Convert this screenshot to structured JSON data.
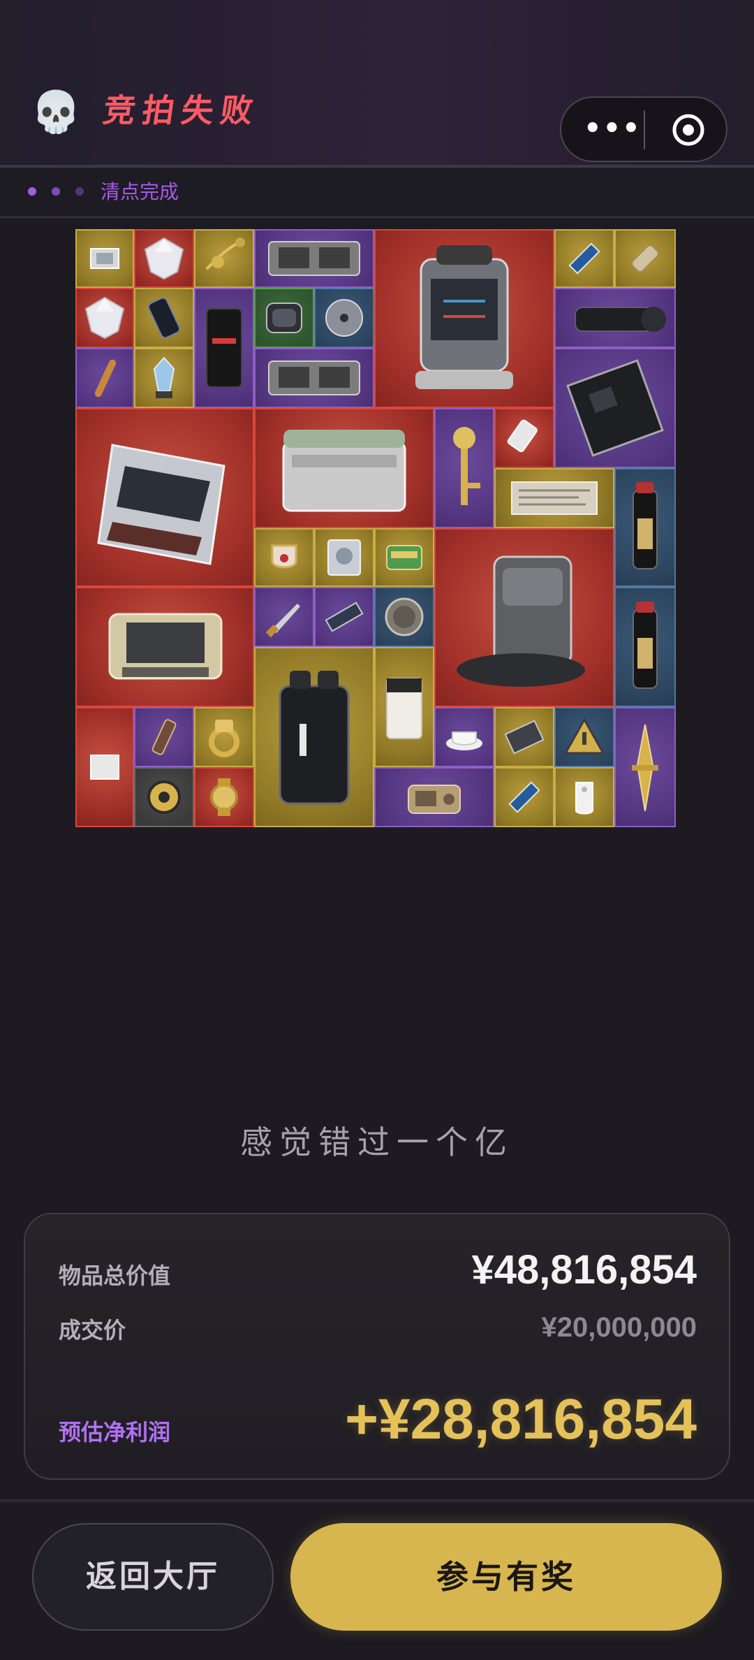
{
  "header": {
    "title": "竞拍失败",
    "skull_icon": "skull-icon",
    "capsule": {
      "more_icon": "more-dots-icon",
      "close_icon": "target-circle-icon"
    }
  },
  "status": {
    "dots": [
      "#a45be6",
      "#7e4bb6",
      "#54357d"
    ],
    "text": "清点完成"
  },
  "inventory": {
    "rarity_colors": {
      "red": "#c74a3d",
      "gold": "#b89c3c",
      "purple": "#6a4a9a",
      "blue": "#3a5877"
    },
    "items": [
      {
        "name": "cpu-chip-icon",
        "rarity": "gold"
      },
      {
        "name": "diamond-icon",
        "rarity": "red"
      },
      {
        "name": "gold-pendant-icon",
        "rarity": "gold"
      },
      {
        "name": "graphics-card-icon",
        "rarity": "purple"
      },
      {
        "name": "reactor-core-icon",
        "rarity": "red"
      },
      {
        "name": "ssd-icon",
        "rarity": "gold"
      },
      {
        "name": "battery-cell-icon",
        "rarity": "gold"
      },
      {
        "name": "diamond-icon",
        "rarity": "red"
      },
      {
        "name": "smartphone-icon",
        "rarity": "gold"
      },
      {
        "name": "coffee-bag-icon",
        "rarity": "purple"
      },
      {
        "name": "power-bank-icon",
        "rarity": "green"
      },
      {
        "name": "optical-disc-icon",
        "rarity": "blue"
      },
      {
        "name": "camera-lens-icon",
        "rarity": "purple"
      },
      {
        "name": "cigar-icon",
        "rarity": "purple"
      },
      {
        "name": "crystal-trophy-icon",
        "rarity": "gold"
      },
      {
        "name": "graphics-card-icon",
        "rarity": "purple"
      },
      {
        "name": "motherboard-icon",
        "rarity": "purple"
      },
      {
        "name": "server-rack-icon",
        "rarity": "red"
      },
      {
        "name": "car-battery-icon",
        "rarity": "red"
      },
      {
        "name": "golden-key-icon",
        "rarity": "purple"
      },
      {
        "name": "usb-drive-icon",
        "rarity": "red"
      },
      {
        "name": "newspaper-icon",
        "rarity": "gold"
      },
      {
        "name": "black-powder-icon",
        "rarity": "blue"
      },
      {
        "name": "ornate-cup-icon",
        "rarity": "gold"
      },
      {
        "name": "hard-drive-icon",
        "rarity": "gold"
      },
      {
        "name": "sardine-tin-icon",
        "rarity": "gold"
      },
      {
        "name": "robot-vacuum-dock-icon",
        "rarity": "red"
      },
      {
        "name": "rugged-laptop-case-icon",
        "rarity": "red"
      },
      {
        "name": "knife-icon",
        "rarity": "purple"
      },
      {
        "name": "ram-stick-icon",
        "rarity": "purple"
      },
      {
        "name": "ancient-coin-icon",
        "rarity": "blue"
      },
      {
        "name": "black-powder-icon",
        "rarity": "blue"
      },
      {
        "name": "power-station-icon",
        "rarity": "gold"
      },
      {
        "name": "coffee-box-icon",
        "rarity": "gold"
      },
      {
        "name": "paper-note-icon",
        "rarity": "red"
      },
      {
        "name": "chocolate-bar-icon",
        "rarity": "purple"
      },
      {
        "name": "gold-ring-icon",
        "rarity": "gold"
      },
      {
        "name": "teacup-icon",
        "rarity": "purple"
      },
      {
        "name": "circuit-board-icon",
        "rarity": "gold"
      },
      {
        "name": "warning-sign-icon",
        "rarity": "blue"
      },
      {
        "name": "golden-dagger-icon",
        "rarity": "purple"
      },
      {
        "name": "tape-measure-icon",
        "rarity": "slate"
      },
      {
        "name": "gold-watch-icon",
        "rarity": "red"
      },
      {
        "name": "radio-icon",
        "rarity": "purple"
      },
      {
        "name": "ssd-icon",
        "rarity": "gold"
      },
      {
        "name": "white-tag-icon",
        "rarity": "gold"
      }
    ]
  },
  "quote": "感觉错过一个亿",
  "summary": {
    "total_label": "物品总价值",
    "total_value": "¥48,816,854",
    "deal_label": "成交价",
    "deal_value": "¥20,000,000",
    "profit_label": "预估净利润",
    "profit_value": "+¥28,816,854"
  },
  "footer": {
    "back_label": "返回大厅",
    "join_label": "参与有奖"
  }
}
